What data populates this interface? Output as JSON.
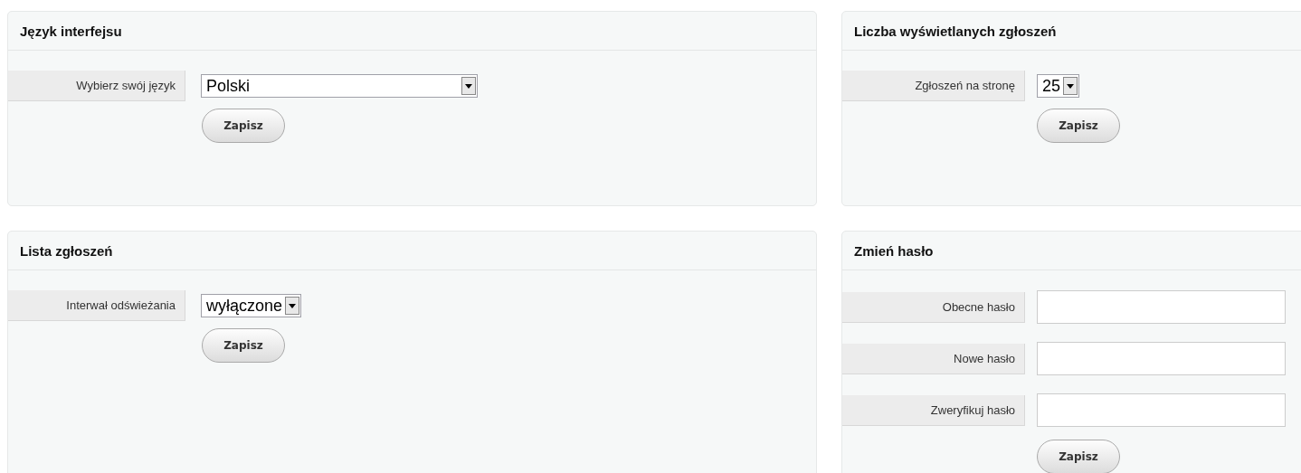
{
  "panels": [
    {
      "title": "Język interfejsu",
      "fields": [
        {
          "kind": "select",
          "label": "Wybierz swój język",
          "value": "Polski"
        }
      ],
      "button": "Zapisz"
    },
    {
      "title": "Liczba wyświetlanych zgłoszeń",
      "fields": [
        {
          "kind": "select",
          "label": "Zgłoszeń na stronę",
          "value": "25"
        }
      ],
      "button": "Zapisz"
    },
    {
      "title": "Lista zgłoszeń",
      "fields": [
        {
          "kind": "select",
          "label": "Interwał odświeżania",
          "value": "wyłączone"
        }
      ],
      "button": "Zapisz"
    },
    {
      "title": "Zmień hasło",
      "fields": [
        {
          "kind": "text",
          "label": "Obecne hasło"
        },
        {
          "kind": "text",
          "label": "Nowe hasło"
        },
        {
          "kind": "text",
          "label": "Zweryfikuj hasło"
        }
      ],
      "button": "Zapisz"
    }
  ]
}
